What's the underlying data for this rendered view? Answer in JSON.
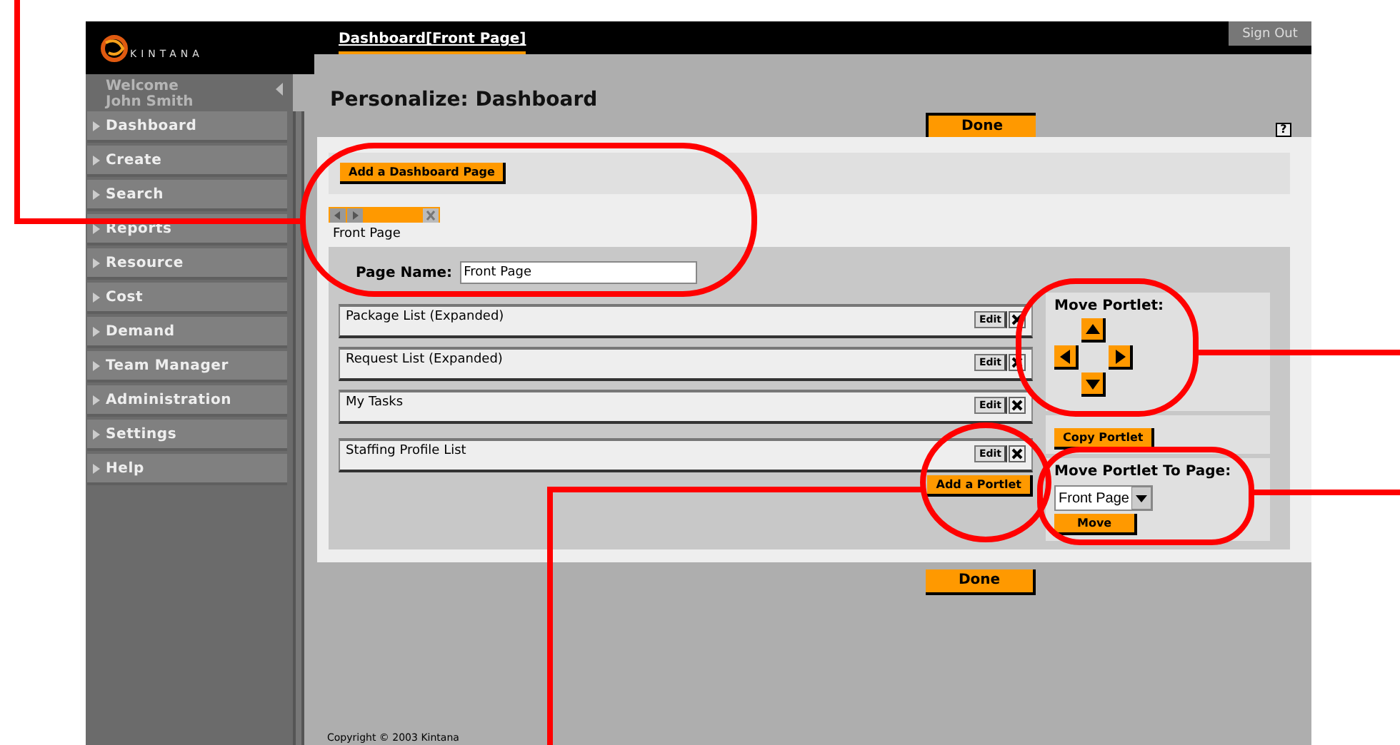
{
  "header": {
    "logo": "KINTANA",
    "breadcrumb": "Dashboard[Front Page]",
    "sign_out": "Sign Out"
  },
  "sidebar": {
    "welcome": "Welcome",
    "user": "John Smith",
    "items": [
      {
        "label": "Dashboard"
      },
      {
        "label": "Create"
      },
      {
        "label": "Search"
      },
      {
        "label": "Reports"
      },
      {
        "label": "Resource"
      },
      {
        "label": "Cost"
      },
      {
        "label": "Demand"
      },
      {
        "label": "Team Manager"
      },
      {
        "label": "Administration"
      },
      {
        "label": "Settings"
      },
      {
        "label": "Help"
      }
    ]
  },
  "page": {
    "title": "Personalize: Dashboard",
    "done_top": "Done",
    "help": "?",
    "add_page": "Add a Dashboard Page",
    "tab": {
      "label": "Front Page"
    },
    "page_name_label": "Page Name:",
    "page_name_value": "Front Page",
    "portlets": [
      {
        "title": "Package List (Expanded)",
        "edit": "Edit"
      },
      {
        "title": "Request List (Expanded)",
        "edit": "Edit"
      },
      {
        "title": "My Tasks",
        "edit": "Edit"
      },
      {
        "title": "Staffing Profile List",
        "edit": "Edit"
      }
    ],
    "add_portlet": "Add a Portlet",
    "move_portlet": {
      "title": "Move Portlet:"
    },
    "copy_portlet": "Copy Portlet",
    "move_to_page": {
      "title": "Move Portlet To Page:",
      "select": "Front Page",
      "button": "Move"
    },
    "done_bottom": "Done"
  },
  "footer": {
    "copyright": "Copyright © 2003 Kintana"
  }
}
